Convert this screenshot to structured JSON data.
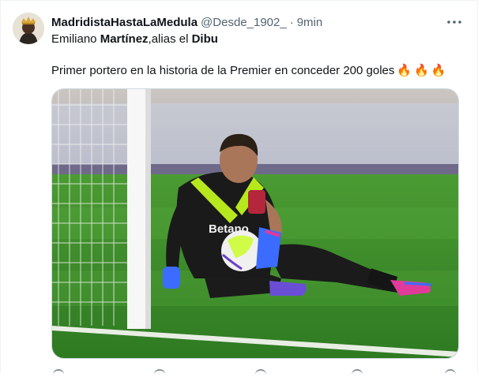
{
  "tweet": {
    "display_name": "MadridistaHastaLaMedula",
    "handle": "@Desde_1902_",
    "separator": "·",
    "time": "9min",
    "more_icon": "more-horizontal-icon",
    "line1_prefix": "Emiliano ",
    "line1_bold1": "Martínez",
    "line1_middle": ",alias el ",
    "line1_bold2": "Dibu",
    "line2_text": "Primer portero en la historia de la Premier en conceder 200 goles",
    "emojis": [
      "🔥",
      "🔥",
      "🔥"
    ],
    "media": {
      "jersey_text": "Betano",
      "description_icon": "photo"
    }
  },
  "colors": {
    "text": "#0f1419",
    "muted": "#536471",
    "border": "#cfd9de",
    "pitch": "#3f8d2c",
    "jersey": "#1a1a1a",
    "accent": "#c8ff1e"
  }
}
